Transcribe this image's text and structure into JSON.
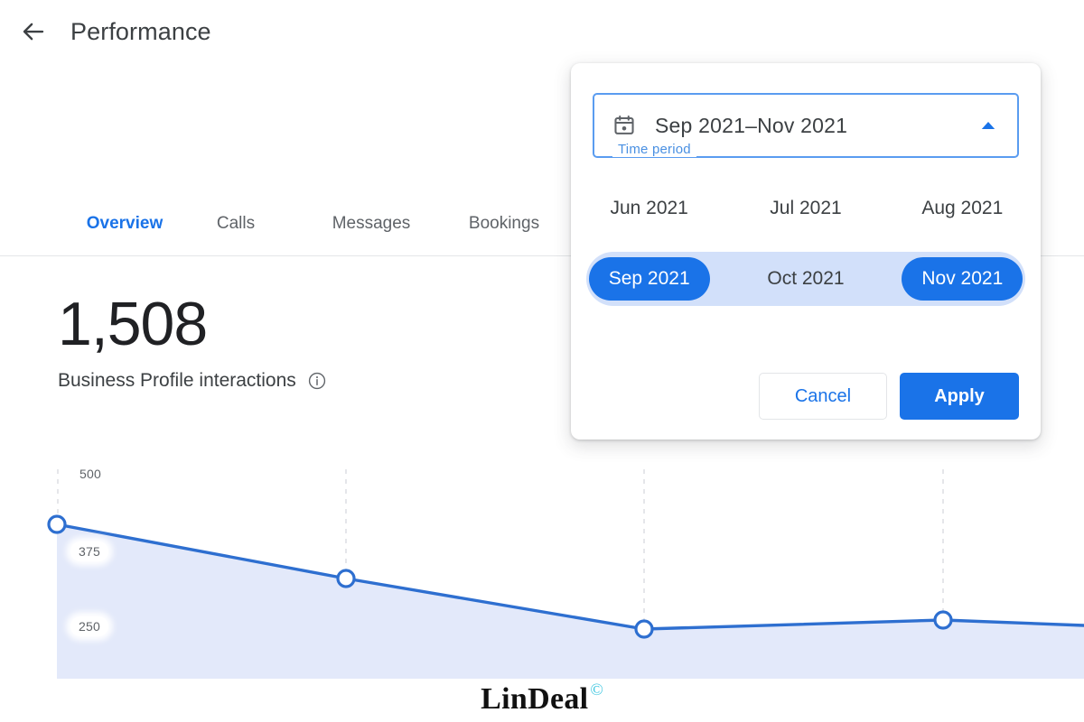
{
  "header": {
    "title": "Performance",
    "back_icon": "arrow-left-icon"
  },
  "tabs": [
    {
      "label": "Overview",
      "active": true
    },
    {
      "label": "Calls",
      "active": false
    },
    {
      "label": "Messages",
      "active": false
    },
    {
      "label": "Bookings",
      "active": false
    }
  ],
  "metric": {
    "value": "1,508",
    "label": "Business Profile interactions",
    "info_icon": "info-icon"
  },
  "time_period": {
    "legend": "Time period",
    "value": "Sep 2021–Nov 2021",
    "calendar_icon": "calendar-icon",
    "caret_icon": "chevron-up-icon",
    "months": [
      {
        "label": "Jun 2021",
        "state": "normal"
      },
      {
        "label": "Jul 2021",
        "state": "normal"
      },
      {
        "label": "Aug 2021",
        "state": "normal"
      },
      {
        "label": "Sep 2021",
        "state": "selected"
      },
      {
        "label": "Oct 2021",
        "state": "in-range"
      },
      {
        "label": "Nov 2021",
        "state": "selected"
      }
    ],
    "cancel_label": "Cancel",
    "apply_label": "Apply"
  },
  "colors": {
    "accent_blue": "#1a73e8",
    "field_border_blue": "#5a9cf0",
    "legend_blue": "#4a90e2",
    "range_band": "#d2e0fa",
    "chart_line": "#2e6fd0",
    "chart_fill": "#e3e9fa",
    "text_primary": "#202124",
    "text_secondary": "#5f6368",
    "watermark_c": "#3cc6e0"
  },
  "watermark": {
    "text": "LinDeal",
    "symbol": "©"
  },
  "chart_data": {
    "type": "area",
    "title": "Business Profile interactions",
    "xlabel": "",
    "ylabel": "",
    "ylim": [
      0,
      500
    ],
    "yticks": [
      500,
      375,
      250
    ],
    "ytick_labels": [
      "500",
      "375",
      "250"
    ],
    "grid": true,
    "legend": "none",
    "x": [
      0,
      1,
      2,
      3,
      4
    ],
    "values": [
      430,
      355,
      305,
      315,
      310
    ],
    "series": [
      {
        "name": "Business Profile interactions",
        "values": [
          430,
          355,
          305,
          315,
          310
        ]
      }
    ]
  }
}
